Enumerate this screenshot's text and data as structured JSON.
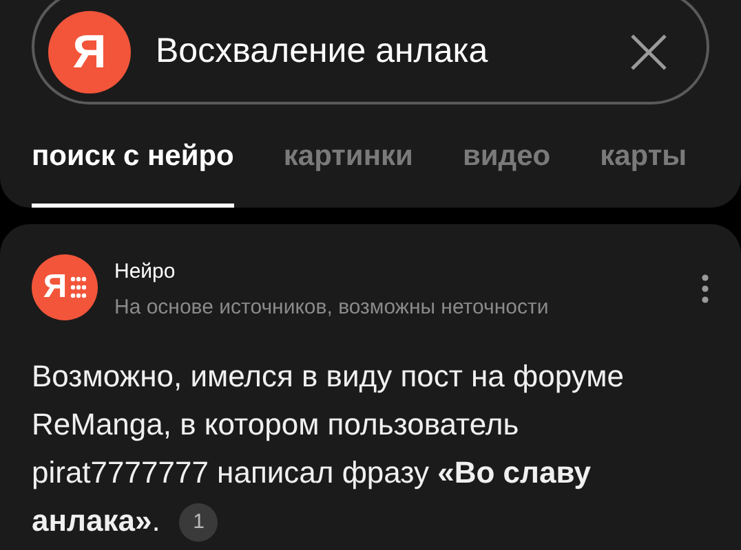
{
  "search": {
    "logo": "Я",
    "value": "Восхваление анлака"
  },
  "tabs": [
    {
      "label": "поиск с нейро",
      "selected": true
    },
    {
      "label": "картинки",
      "selected": false
    },
    {
      "label": "видео",
      "selected": false
    },
    {
      "label": "карты",
      "selected": false
    }
  ],
  "answer": {
    "logo": "Я",
    "title": "Нейро",
    "subtitle": "На основе источников, возможны неточности",
    "text": "Возможно, имелся в виду пост на форуме ReManga, в котором пользователь pirat7777777 написал фразу **«Во славу анлака»**.",
    "citation": "1"
  }
}
